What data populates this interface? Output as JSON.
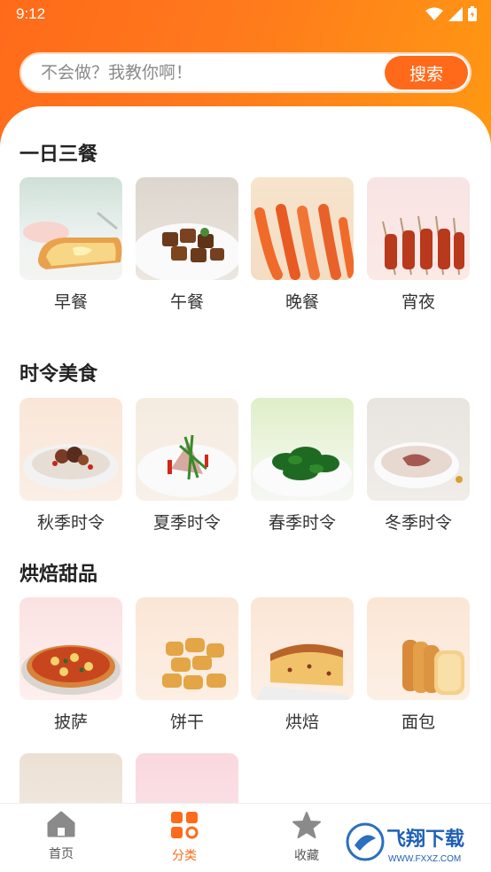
{
  "status": {
    "time": "9:12"
  },
  "search": {
    "placeholder": "不会做？我教你啊！",
    "button_label": "搜索"
  },
  "sections": [
    {
      "title": "一日三餐",
      "items": [
        {
          "label": "早餐",
          "image": "toast-image"
        },
        {
          "label": "午餐",
          "image": "braised-meat-image"
        },
        {
          "label": "晚餐",
          "image": "shrimp-image"
        },
        {
          "label": "宵夜",
          "image": "skewers-image"
        }
      ]
    },
    {
      "title": "时令美食",
      "items": [
        {
          "label": "秋季时令",
          "image": "soup-bowl-image"
        },
        {
          "label": "夏季时令",
          "image": "salad-image"
        },
        {
          "label": "春季时令",
          "image": "greens-image"
        },
        {
          "label": "冬季时令",
          "image": "stew-image"
        }
      ]
    },
    {
      "title": "烘焙甜品",
      "items": [
        {
          "label": "披萨",
          "image": "pizza-image"
        },
        {
          "label": "饼干",
          "image": "cookies-image"
        },
        {
          "label": "烘焙",
          "image": "cake-image"
        },
        {
          "label": "面包",
          "image": "bread-image"
        }
      ]
    }
  ],
  "bottom_nav": [
    {
      "label": "首页",
      "icon": "home-icon",
      "active": false
    },
    {
      "label": "分类",
      "icon": "category-icon",
      "active": true
    },
    {
      "label": "收藏",
      "icon": "star-icon",
      "active": false
    }
  ],
  "colors": {
    "accent": "#ff6a1a",
    "gradient_end": "#ff9a12"
  },
  "watermark": {
    "text": "飞翔下载",
    "subtext": "WWW.FXXZ.COM"
  }
}
